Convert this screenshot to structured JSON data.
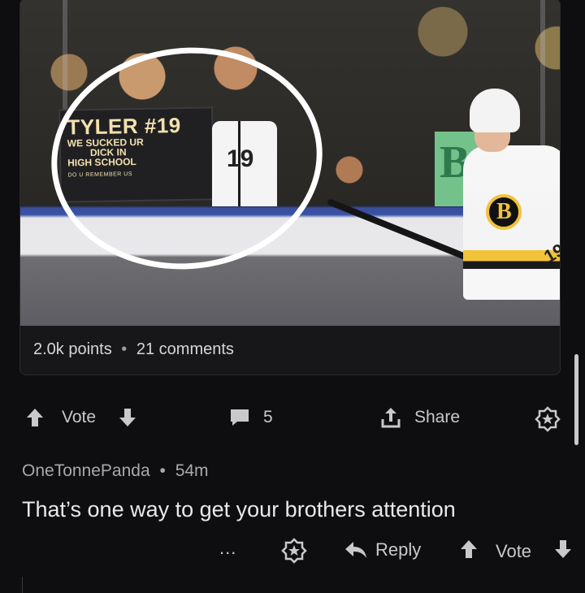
{
  "post": {
    "image": {
      "sign_title": "TYLER #19",
      "sign_lines": [
        "WE SUCKED UR",
        "DICK IN",
        "HIGH SCHOOL"
      ],
      "sign_footer": "DO U REMEMBER US",
      "player_number": "19",
      "fan_jersey_number": "19",
      "green_sign_letter": "B"
    },
    "points": "2.0k points",
    "separator": "•",
    "comments": "21 comments"
  },
  "actions": {
    "vote_label": "Vote",
    "comment_count": "5",
    "share_label": "Share",
    "upvote_icon": "arrow-up-icon",
    "downvote_icon": "arrow-down-icon",
    "comment_icon": "speech-bubble-icon",
    "share_icon": "share-icon",
    "award_icon": "award-icon"
  },
  "comment": {
    "author": "OneTonnePanda",
    "separator": "•",
    "age": "54m",
    "body": "That’s one way to get your brothers attention",
    "more_label": "...",
    "reply_label": "Reply",
    "vote_label": "Vote"
  },
  "colors": {
    "background": "#0e0e10",
    "card": "#17171a",
    "text": "#d7d7d9",
    "muted": "#a8a8ad"
  }
}
